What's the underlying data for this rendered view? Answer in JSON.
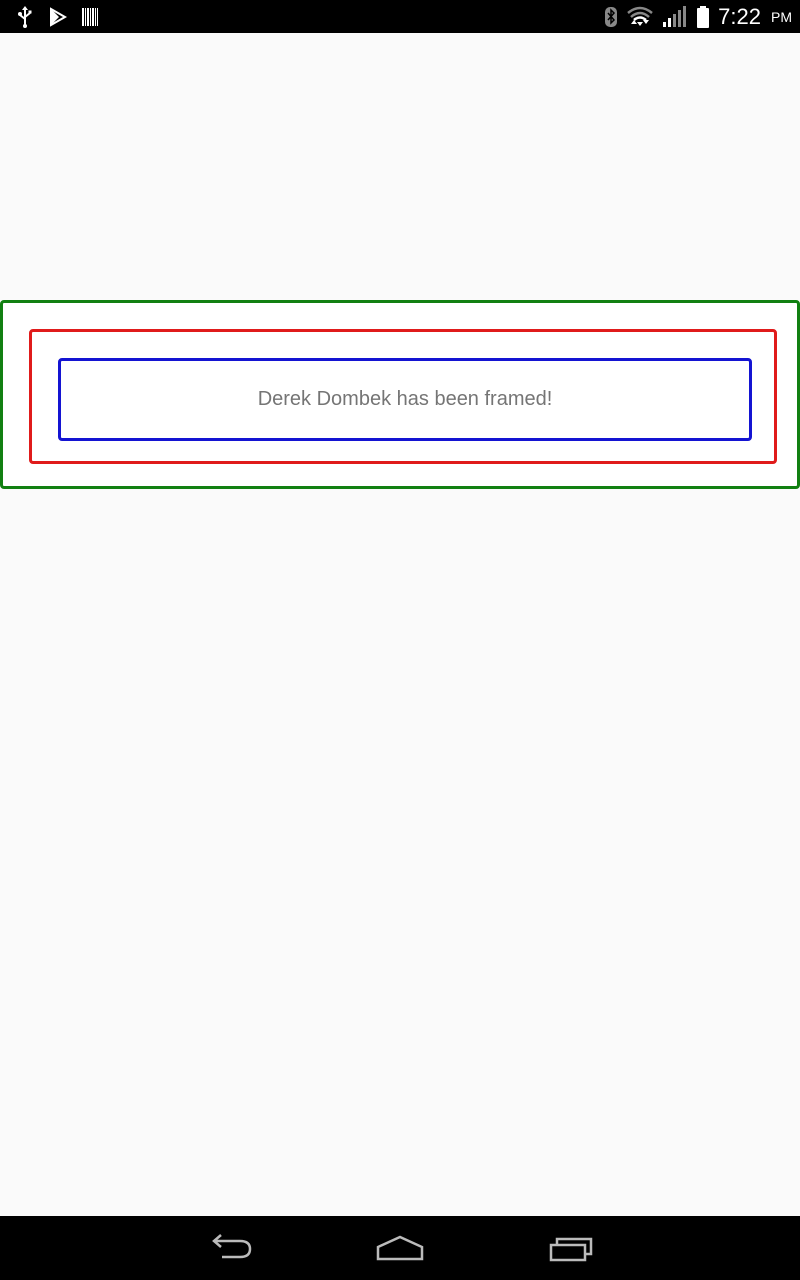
{
  "status_bar": {
    "time": "7:22",
    "ampm": "PM",
    "left_icons": [
      "usb-icon",
      "play-store-icon",
      "barcode-icon"
    ],
    "right_icons": [
      "bluetooth-icon",
      "wifi-icon",
      "signal-icon",
      "battery-icon"
    ]
  },
  "main": {
    "frame_text": "Derek Dombek has been framed!",
    "frame_colors": {
      "outer": "#118011",
      "middle": "#e01b1b",
      "inner": "#1414d2"
    }
  },
  "nav_bar": {
    "buttons": [
      "back-icon",
      "home-icon",
      "recents-icon"
    ]
  }
}
